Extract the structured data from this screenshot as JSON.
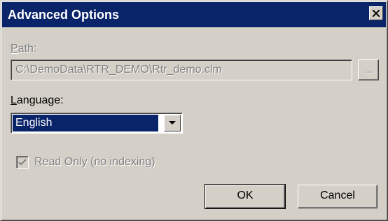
{
  "dialog": {
    "title": "Advanced Options",
    "close_icon": "close-icon"
  },
  "path": {
    "label": "Path:",
    "value": "C:\\DemoData\\RTR_DEMO\\Rtr_demo.clm",
    "browse_label": "...",
    "enabled": false
  },
  "language": {
    "label": "Language:",
    "selected": "English",
    "dropdown_icon": "chevron-down-icon"
  },
  "read_only": {
    "label": "Read Only (no indexing)",
    "checked": true,
    "enabled": false
  },
  "buttons": {
    "ok": "OK",
    "cancel": "Cancel"
  },
  "colors": {
    "title_bar": "#0a246a",
    "dialog_face": "#d4d0c8",
    "selection": "#0a246a",
    "disabled_text": "#808080"
  }
}
